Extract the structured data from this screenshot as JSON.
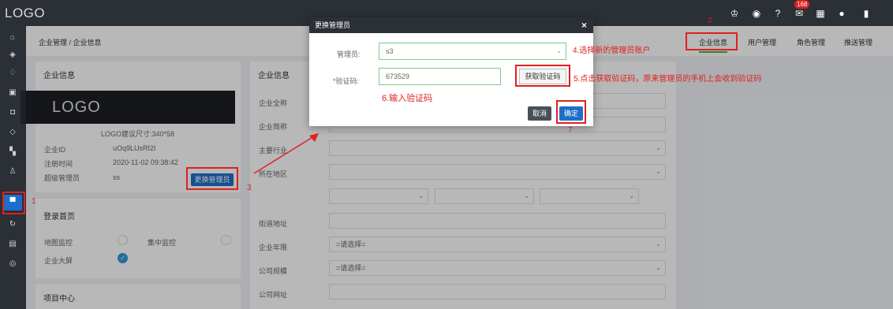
{
  "app": {
    "logo": "LOGO",
    "notification_count": "168"
  },
  "topbar": {
    "icons": [
      "tag-icon",
      "gauge-icon",
      "help-icon",
      "mail-icon",
      "grid-icon",
      "user-icon",
      "logout-icon"
    ]
  },
  "sidebar": {
    "icons": [
      "home-icon",
      "shield-icon",
      "bell-icon",
      "clipboard-icon",
      "camera-icon",
      "layers-icon",
      "apps-icon",
      "person-icon",
      "building-icon",
      "refresh-icon",
      "server-icon",
      "database-icon"
    ]
  },
  "breadcrumb": "企业管理 / 企业信息",
  "tabs": [
    "企业信息",
    "用户管理",
    "角色管理",
    "推送管理"
  ],
  "left_card": {
    "title": "企业信息",
    "logo_text": "LOGO",
    "logo_hint": "LOGO建议尺寸:340*58",
    "rows": [
      {
        "label": "企业ID",
        "value": "uOq9LUsRI2I"
      },
      {
        "label": "注册时间",
        "value": "2020-11-02 09:38:42"
      },
      {
        "label": "超级管理员",
        "value": "ss"
      }
    ],
    "change_admin_button": "更换管理员"
  },
  "login_card": {
    "title": "登录首页",
    "options": [
      {
        "label": "地图监控",
        "checked": false
      },
      {
        "label": "集中监控",
        "checked": false
      },
      {
        "label": "企业大屏",
        "checked": true
      }
    ]
  },
  "project_card": {
    "title": "项目中心"
  },
  "right_card": {
    "title": "企业信息",
    "fields": [
      {
        "label": "企业全称",
        "value": ""
      },
      {
        "label": "企业简称",
        "value": ""
      },
      {
        "label": "主要行业",
        "value": ""
      },
      {
        "label": "所在地区",
        "value": ""
      },
      {
        "label": "街道地址",
        "value": ""
      },
      {
        "label": "企业年限",
        "value": "=请选择="
      },
      {
        "label": "公司规模",
        "value": "=请选择="
      },
      {
        "label": "公司网址",
        "value": ""
      }
    ]
  },
  "modal": {
    "title": "更换管理员",
    "close": "×",
    "admin_label": "管理员:",
    "admin_value": "s3",
    "code_label": "*验证码:",
    "code_value": "673529",
    "get_code_button": "获取验证码",
    "cancel_button": "取消",
    "confirm_button": "确定"
  },
  "annotations": {
    "a1": "1",
    "a2": "2",
    "a3": "3",
    "a4": "4.选择新的管理员账户",
    "a5": "5.点击获取验证码，原来管理员的手机上会收到验证码",
    "a6": "6.输入验证码",
    "a7": "7"
  },
  "colors": {
    "accent": "#1e6ec9",
    "annotation": "#e02020",
    "dark": "#2b2f36",
    "success": "#44b549"
  }
}
